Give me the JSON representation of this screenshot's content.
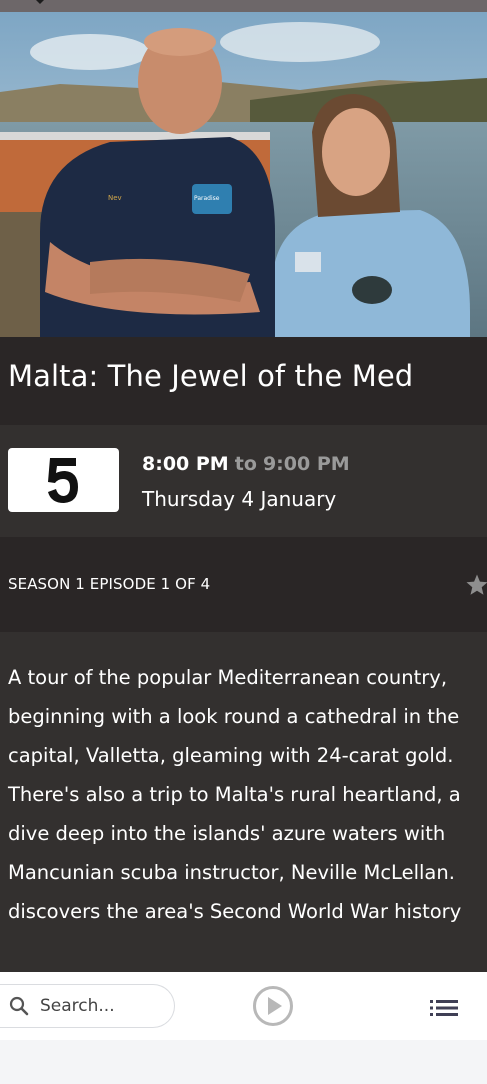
{
  "program": {
    "title": "Malta: The Jewel of the Med",
    "channel_icon": "channel-5-logo",
    "start_time": "8:00 PM",
    "to_label": "to",
    "end_time": "9:00 PM",
    "date": "Thursday 4 January",
    "episode_label": "SEASON 1 EPISODE 1 OF 4",
    "description": "A tour of the popular Mediterranean country,\nbeginning with a look round a cathedral in the\ncapital, Valletta, gleaming with 24-carat gold.\nThere's also a trip to Malta's rural heartland, a\ndive deep into the islands' azure waters with\nMancunian scuba instructor, Neville McLellan.\ndiscovers the area's Second World War history"
  },
  "hero_image": {
    "shirt_text_left": "Nev",
    "badge_text": "Paradise"
  },
  "bottom_nav": {
    "search_placeholder": "Search...",
    "search_icon": "magnifier-icon",
    "play_icon": "play-circle-icon",
    "menu_icon": "list-menu-icon"
  },
  "colors": {
    "title_band": "#2a2626",
    "info_band": "#33302f",
    "to_text": "#9a9a9a",
    "nav_background": "#ffffff"
  }
}
